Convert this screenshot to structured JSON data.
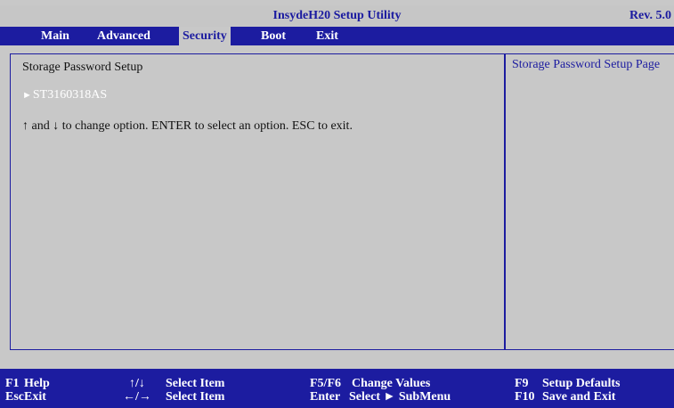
{
  "title": "InsydeH20 Setup Utility",
  "revision": "Rev. 5.0",
  "menu": [
    {
      "label": "Main"
    },
    {
      "label": "Advanced"
    },
    {
      "label": "Security",
      "active": true
    },
    {
      "label": "Boot"
    },
    {
      "label": "Exit"
    }
  ],
  "main": {
    "page_title": "Storage Password Setup",
    "item_label": "ST3160318AS",
    "instructions": "↑ and ↓ to change option. ENTER to select an option. ESC to exit."
  },
  "help": {
    "text": "Storage Password Setup Page"
  },
  "footer": [
    {
      "key": "F1",
      "action": "Help"
    },
    {
      "key": "Esc",
      "action": "Exit"
    },
    {
      "key": "↑/↓",
      "action": "Select Item"
    },
    {
      "key": "←/→",
      "action": "Select Item"
    },
    {
      "key": "F5/F6",
      "action": "Change Values"
    },
    {
      "key": "Enter",
      "action": "Select ► SubMenu"
    },
    {
      "key": "F9",
      "action": "Setup Defaults"
    },
    {
      "key": "F10",
      "action": "Save and Exit"
    }
  ],
  "colors": {
    "background": "#c8c8c8",
    "accent_blue": "#1c1ca0",
    "highlight_text": "#ffffff"
  }
}
